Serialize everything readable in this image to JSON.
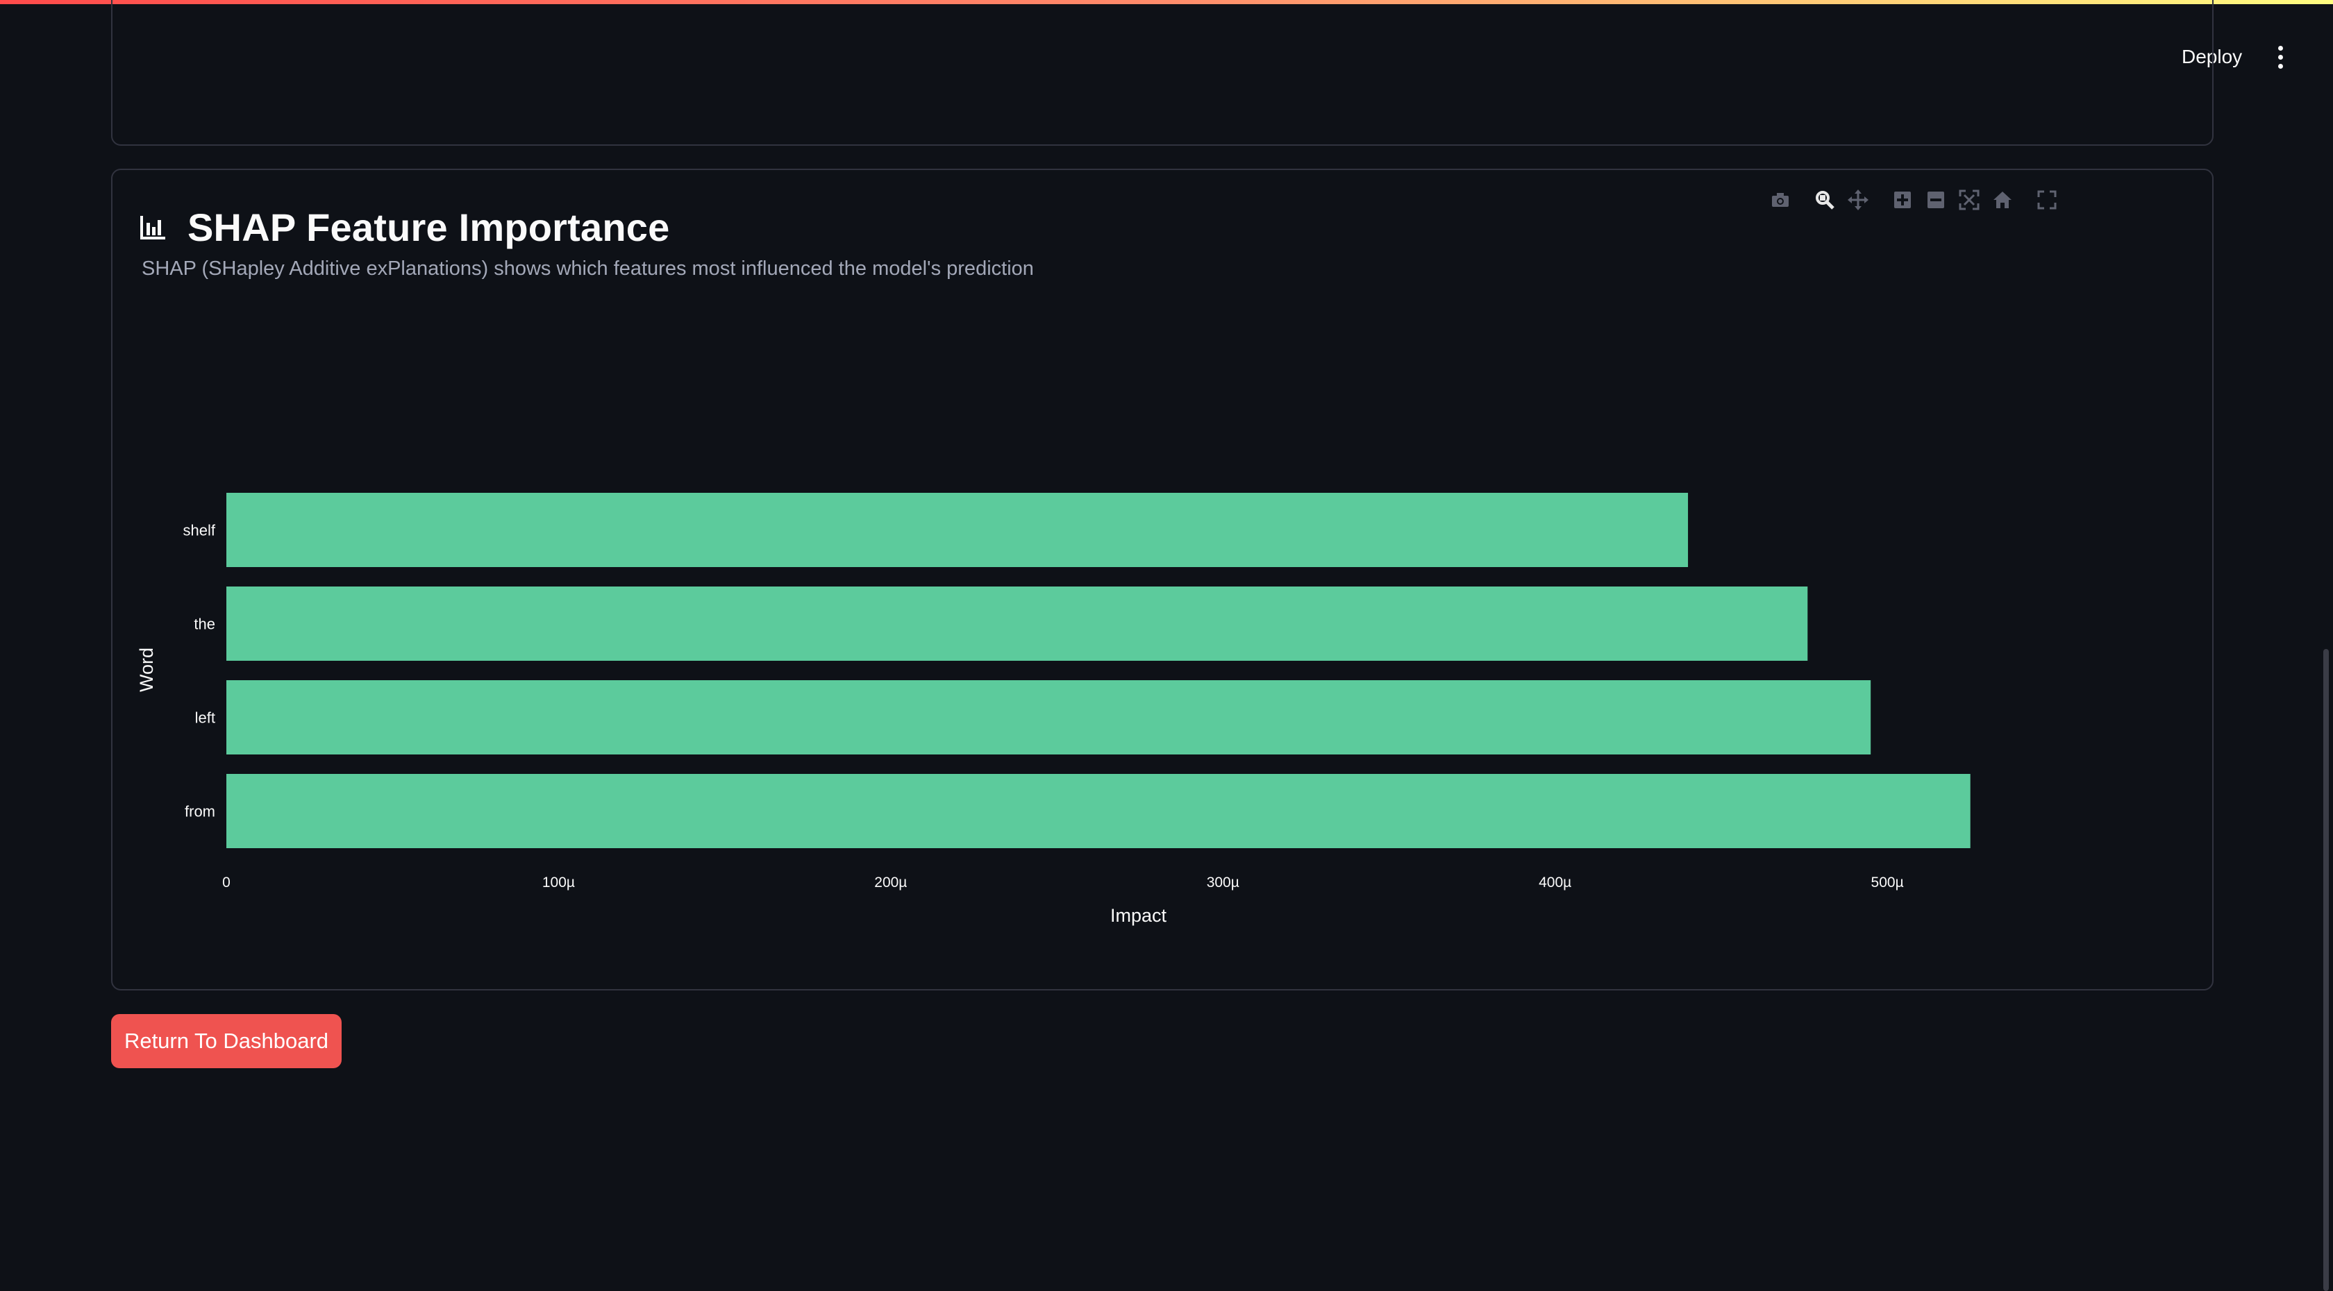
{
  "header": {
    "deploy_label": "Deploy",
    "menu_icon": "kebab-menu-icon"
  },
  "shap_section": {
    "title": "SHAP Feature Importance",
    "title_icon": "bar-chart-icon",
    "subtitle": "SHAP (SHapley Additive exPlanations) shows which features most influenced the model's prediction"
  },
  "modebar": {
    "buttons": [
      "camera-icon",
      "zoom-icon",
      "pan-icon",
      "zoom-in-icon",
      "zoom-out-icon",
      "autoscale-icon",
      "reset-axes-icon",
      "fullscreen-icon"
    ]
  },
  "chart_data": {
    "type": "bar",
    "orientation": "horizontal",
    "categories": [
      "shelf",
      "the",
      "left",
      "from"
    ],
    "values": [
      0.00044,
      0.000476,
      0.000495,
      0.000525
    ],
    "xlabel": "Impact",
    "ylabel": "Word",
    "xticks": [
      0,
      0.0001,
      0.0002,
      0.0003,
      0.0004,
      0.0005
    ],
    "xtick_labels": [
      "0",
      "100µ",
      "200µ",
      "300µ",
      "400µ",
      "500µ"
    ],
    "bar_color": "#5ccb9c",
    "grid": false
  },
  "actions": {
    "return_label": "Return To Dashboard"
  },
  "colors": {
    "background": "#0e1117",
    "accent_button": "#ef5350",
    "card_border": "#31333f"
  }
}
